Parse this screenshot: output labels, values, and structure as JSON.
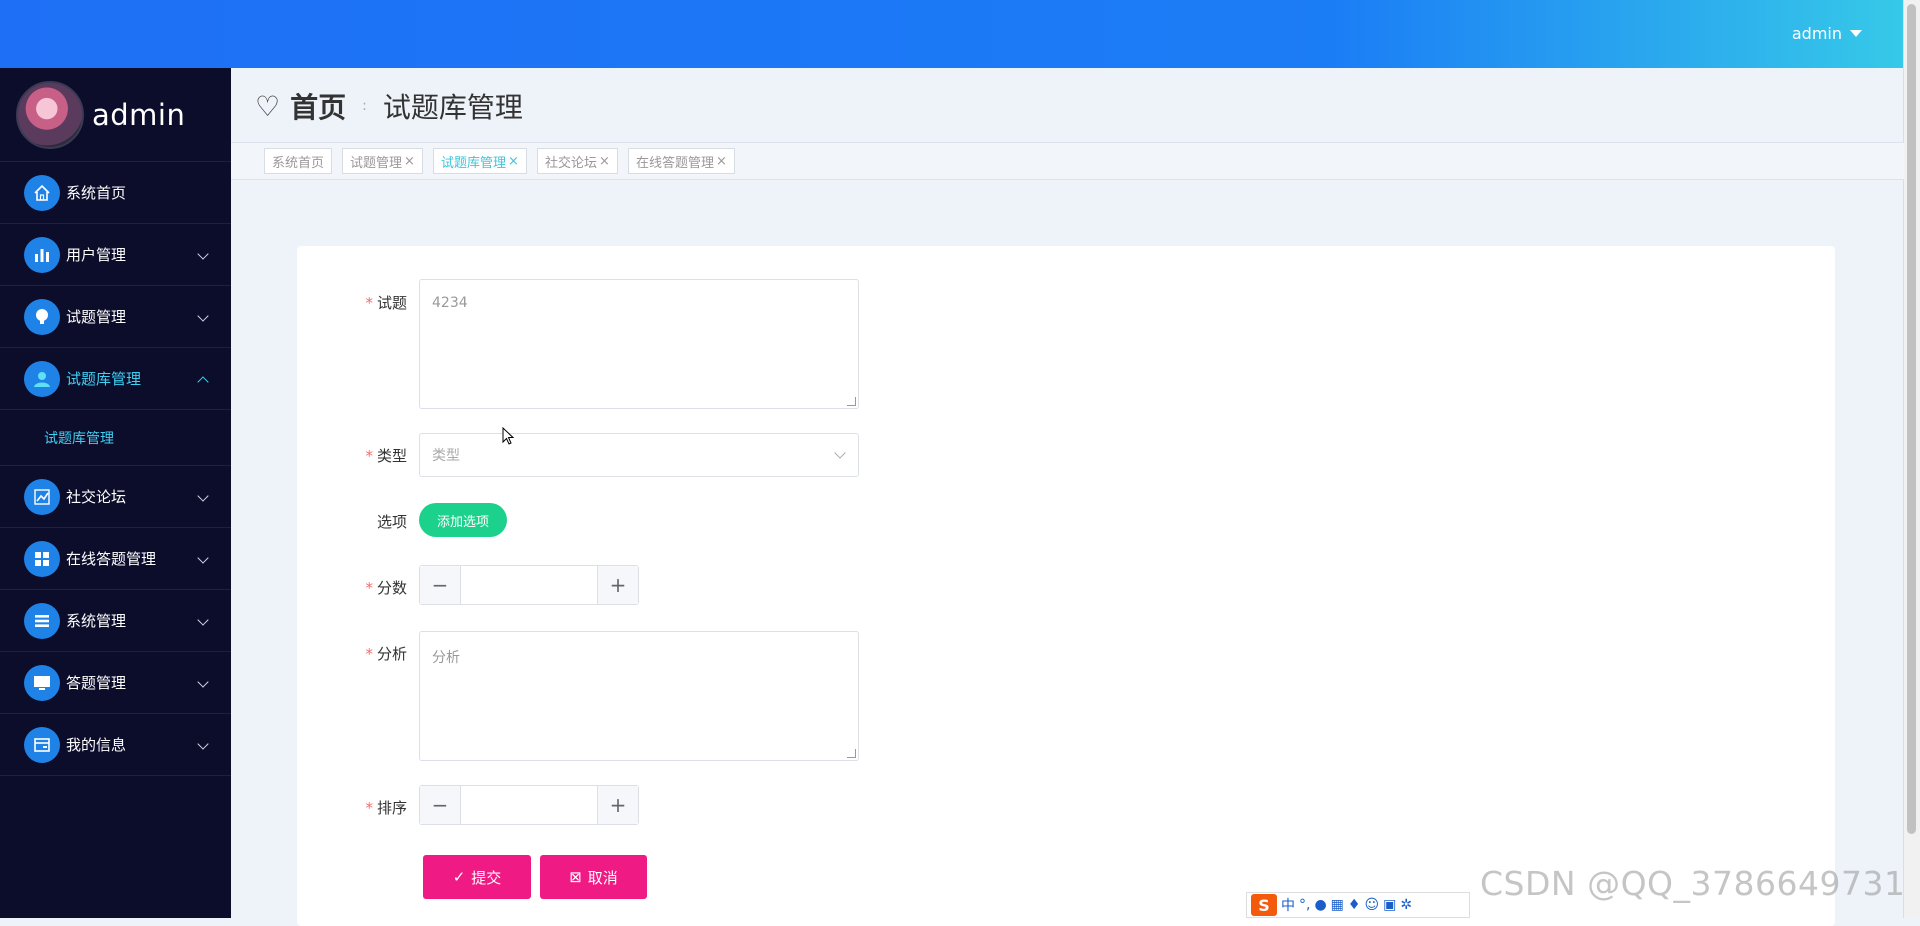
{
  "header": {
    "user": "admin"
  },
  "sidebar": {
    "profile_name": "admin",
    "items": [
      {
        "label": "系统首页",
        "icon": "home-icon",
        "has_children": false
      },
      {
        "label": "用户管理",
        "icon": "bar-chart-icon",
        "has_children": true
      },
      {
        "label": "试题管理",
        "icon": "bulb-icon",
        "has_children": true
      },
      {
        "label": "试题库管理",
        "icon": "user-icon",
        "has_children": true,
        "open": true,
        "children": [
          {
            "label": "试题库管理"
          }
        ]
      },
      {
        "label": "社交论坛",
        "icon": "line-chart-icon",
        "has_children": true
      },
      {
        "label": "在线答题管理",
        "icon": "grid-icon",
        "has_children": true
      },
      {
        "label": "系统管理",
        "icon": "list-icon",
        "has_children": true
      },
      {
        "label": "答题管理",
        "icon": "monitor-icon",
        "has_children": true
      },
      {
        "label": "我的信息",
        "icon": "card-icon",
        "has_children": true
      }
    ]
  },
  "breadcrumb": {
    "home": "首页",
    "current": "试题库管理"
  },
  "tabs": [
    {
      "label": "系统首页",
      "closable": false
    },
    {
      "label": "试题管理",
      "closable": true
    },
    {
      "label": "试题库管理",
      "closable": true,
      "active": true
    },
    {
      "label": "社交论坛",
      "closable": true
    },
    {
      "label": "在线答题管理",
      "closable": true
    }
  ],
  "form": {
    "question_label": "试题",
    "question_value": "4234",
    "type_label": "类型",
    "type_placeholder": "类型",
    "options_label": "选项",
    "add_option_label": "添加选项",
    "score_label": "分数",
    "analysis_label": "分析",
    "analysis_placeholder": "分析",
    "order_label": "排序",
    "submit_label": "提交",
    "cancel_label": "取消"
  },
  "watermark": "CSDN @QQ_3786649731",
  "ime": {
    "mode": "中"
  },
  "colors": {
    "accent": "#1e6ff5",
    "sidebar_bg": "#0c0c2b",
    "active_text": "#3fd0f2",
    "add_button": "#1cd18b",
    "primary_button": "#ef1a83"
  }
}
